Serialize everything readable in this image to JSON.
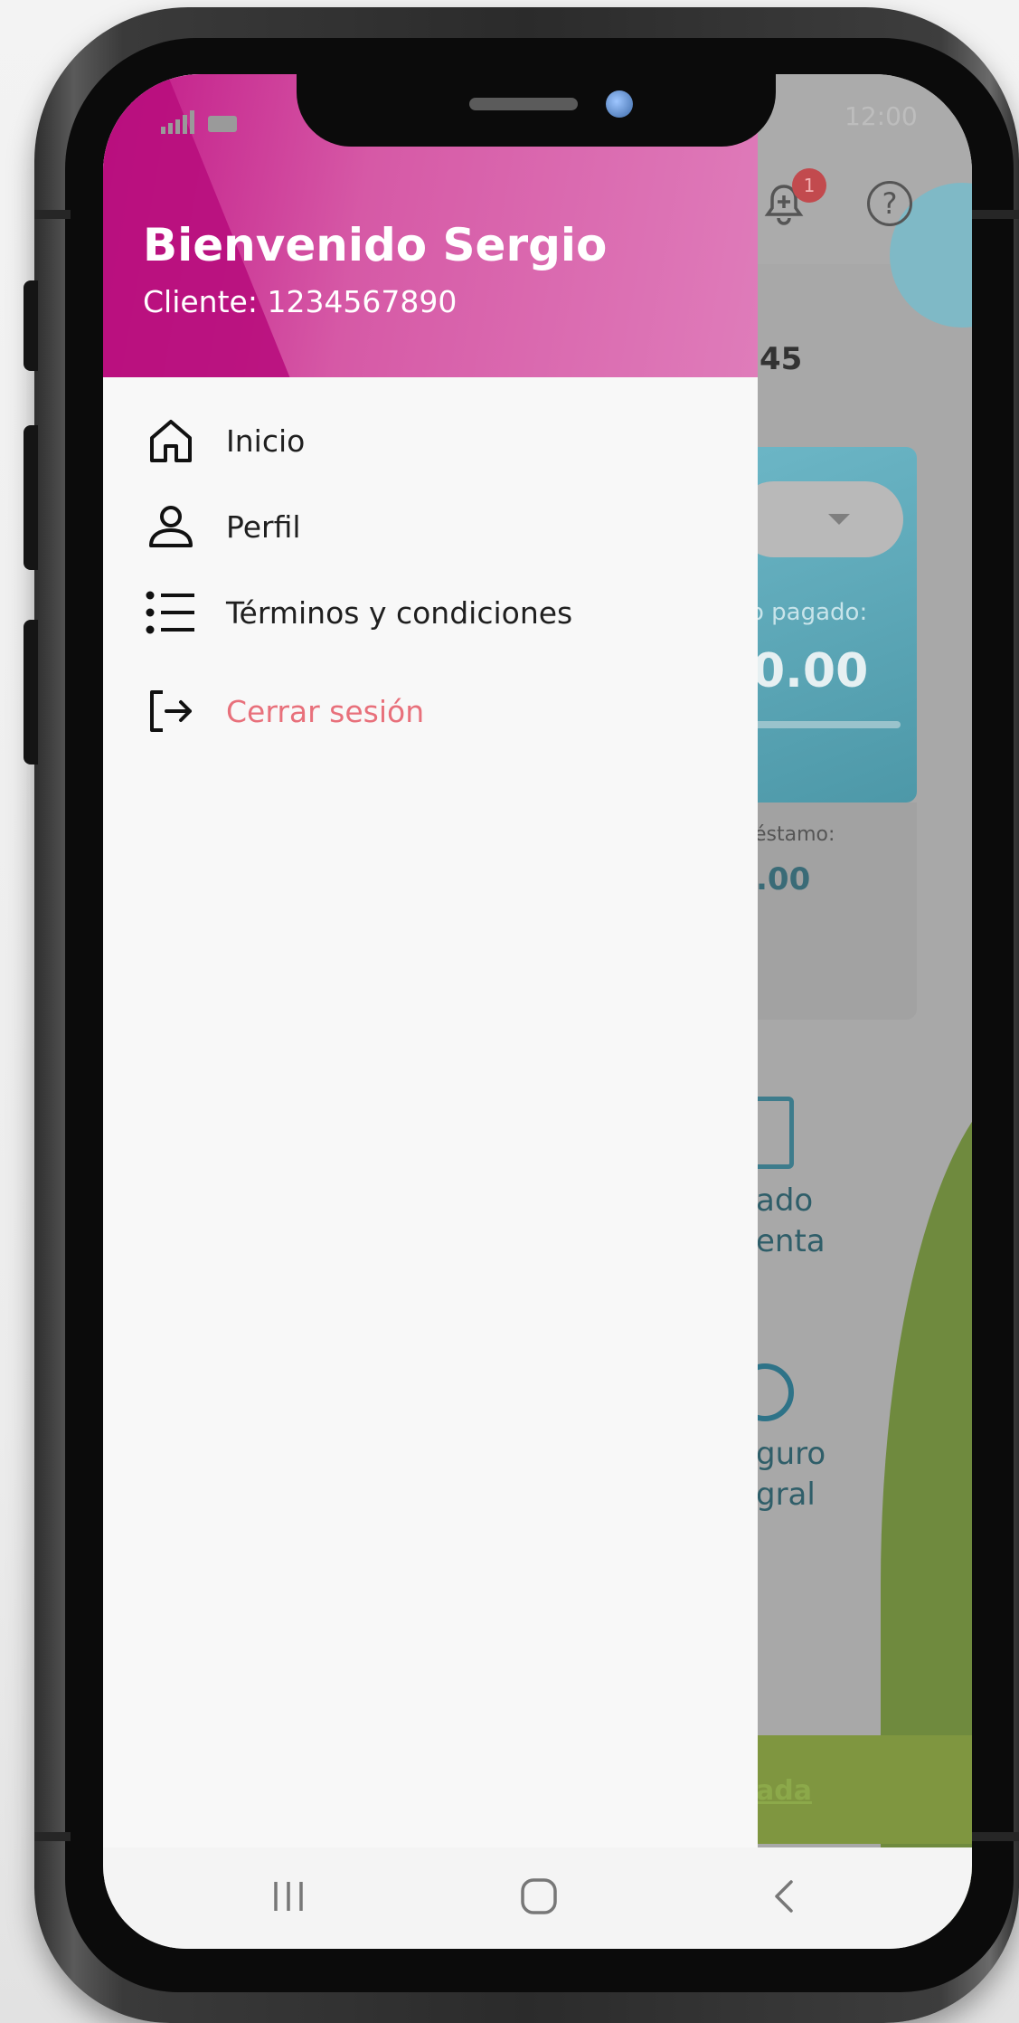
{
  "drawer": {
    "welcome": "Bienvenido Sergio",
    "client": "Cliente: 1234567890",
    "items": [
      {
        "label": "Inicio",
        "icon": "home-icon"
      },
      {
        "label": "Perfil",
        "icon": "user-icon"
      },
      {
        "label": "Términos y condiciones",
        "icon": "list-icon"
      }
    ],
    "logout": {
      "label": "Cerrar sesión",
      "icon": "logout-icon"
    }
  },
  "background_app": {
    "status_time": "12:00",
    "notification_count": "1",
    "help_symbol": "?",
    "number_fragment": "45",
    "paid_label_fragment": "o pagado:",
    "paid_value_fragment": "0.00",
    "loan_label_fragment": "éstamo:",
    "loan_value_fragment": ".00",
    "statement_fragment_1": "ado",
    "statement_fragment_2": "enta",
    "insurance_fragment_1": "guro",
    "insurance_fragment_2": "gral",
    "link_fragment": "ada"
  },
  "colors": {
    "header_start": "#c11787",
    "header_end": "#df7cba",
    "logout": "#e8707b"
  }
}
